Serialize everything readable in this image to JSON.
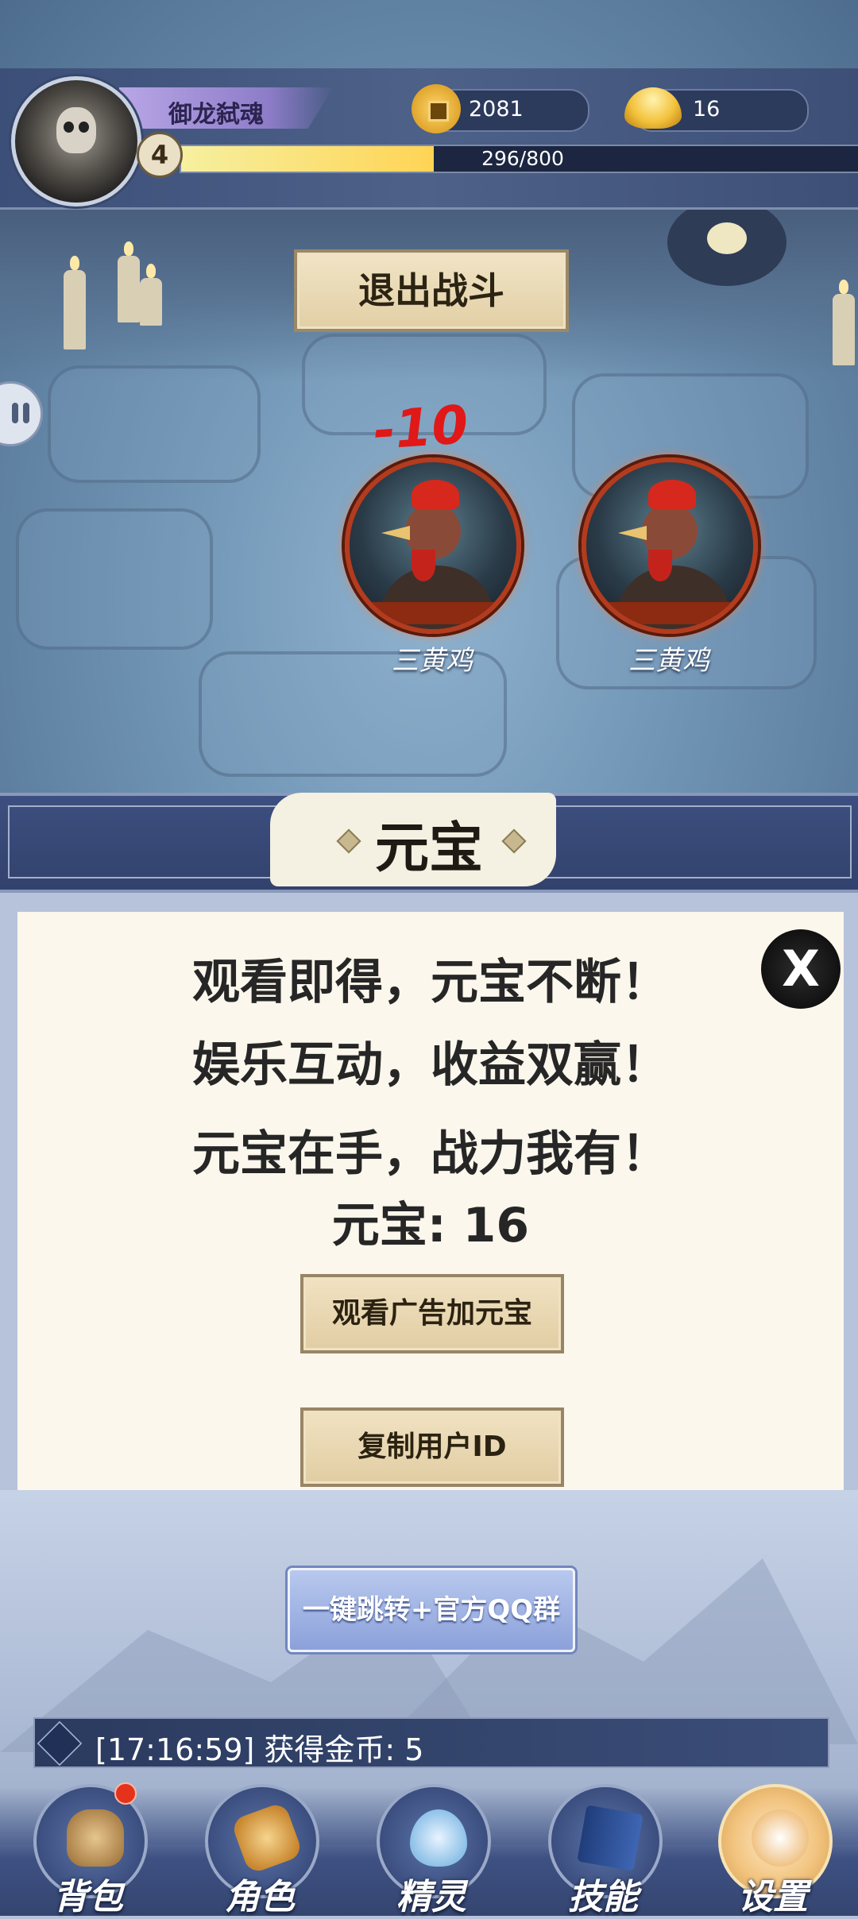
{
  "player": {
    "name": "御龙弑魂",
    "level": "4",
    "coins": "2081",
    "ingots": "16",
    "exp_text": "296/800",
    "exp_fraction": 0.37
  },
  "battle": {
    "exit_label": "退出战斗",
    "damage_text": "-10",
    "enemies": [
      {
        "name": "三黄鸡"
      },
      {
        "name": "三黄鸡"
      }
    ]
  },
  "panel": {
    "title": "元宝",
    "close_label": "X",
    "lines": [
      "观看即得，元宝不断！",
      "娱乐互动，收益双赢！",
      "元宝在手，战力我有！"
    ],
    "balance_text": "元宝: 16",
    "watch_ad_label": "观看广告加元宝",
    "copy_id_label": "复制用户ID"
  },
  "qq_button_label": "一键跳转+官方QQ群",
  "log": {
    "text": "[17:16:59] 获得金币:   5"
  },
  "nav": {
    "items": [
      {
        "label": "背包",
        "icon": "bag-icon"
      },
      {
        "label": "角色",
        "icon": "role-scroll-icon"
      },
      {
        "label": "精灵",
        "icon": "spirit-egg-icon"
      },
      {
        "label": "技能",
        "icon": "skill-book-icon"
      },
      {
        "label": "设置",
        "icon": "settings-icon"
      }
    ]
  },
  "colors": {
    "header_bg": "#4d6189",
    "exp_fill": "#ffd455",
    "damage": "#e01818",
    "enemy_ring": "#b33b1e",
    "panel_bg": "#fbf7ec",
    "button_bg": "#e1cda3",
    "qq_button": "#8ba1da"
  }
}
